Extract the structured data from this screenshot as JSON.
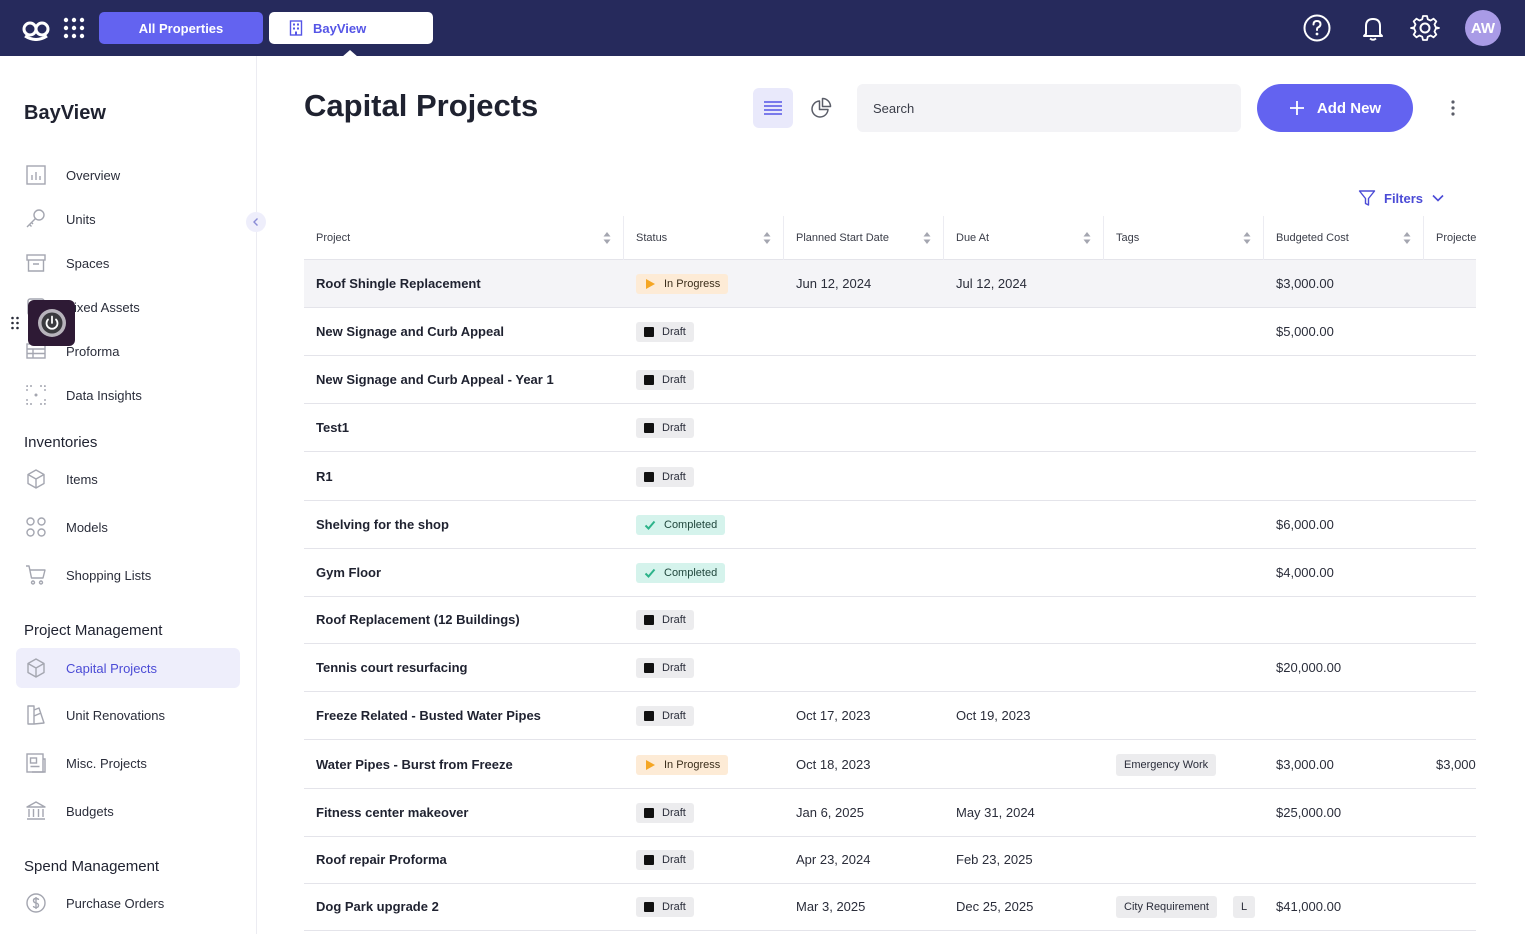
{
  "topbar": {
    "all_properties_label": "All Properties",
    "property_tab_label": "BayView",
    "avatar_initials": "AW"
  },
  "sidebar": {
    "title": "BayView",
    "main_items": [
      {
        "label": "Overview",
        "icon": "chart-icon"
      },
      {
        "label": "Units",
        "icon": "key-icon"
      },
      {
        "label": "Spaces",
        "icon": "box-icon"
      },
      {
        "label": "Fixed Assets",
        "icon": "asset-icon"
      },
      {
        "label": "Proforma",
        "icon": "table-icon"
      },
      {
        "label": "Data Insights",
        "icon": "insights-icon"
      }
    ],
    "inventories": {
      "title": "Inventories",
      "items": [
        {
          "label": "Items",
          "icon": "cube-icon"
        },
        {
          "label": "Models",
          "icon": "grid-icon"
        },
        {
          "label": "Shopping Lists",
          "icon": "cart-icon"
        }
      ]
    },
    "project_management": {
      "title": "Project Management",
      "items": [
        {
          "label": "Capital Projects",
          "icon": "cube-icon",
          "active": true
        },
        {
          "label": "Unit Renovations",
          "icon": "paint-icon"
        },
        {
          "label": "Misc. Projects",
          "icon": "document-icon"
        },
        {
          "label": "Budgets",
          "icon": "bank-icon"
        }
      ]
    },
    "spend_management": {
      "title": "Spend Management",
      "items": [
        {
          "label": "Purchase Orders",
          "icon": "dollar-icon"
        }
      ]
    }
  },
  "main": {
    "title": "Capital Projects",
    "search_placeholder": "Search",
    "add_new_label": "Add New",
    "filters_label": "Filters"
  },
  "table": {
    "columns": [
      "Project",
      "Status",
      "Planned Start Date",
      "Due At",
      "Tags",
      "Budgeted Cost",
      "Projected"
    ],
    "rows": [
      {
        "project": "Roof Shingle Replacement",
        "status": "In Progress",
        "start": "Jun 12, 2024",
        "due": "Jul 12, 2024",
        "tags": [],
        "budget": "$3,000.00",
        "projected": ""
      },
      {
        "project": "New Signage and Curb Appeal",
        "status": "Draft",
        "start": "",
        "due": "",
        "tags": [],
        "budget": "$5,000.00",
        "projected": ""
      },
      {
        "project": "New Signage and Curb Appeal - Year 1",
        "status": "Draft",
        "start": "",
        "due": "",
        "tags": [],
        "budget": "",
        "projected": ""
      },
      {
        "project": "Test1",
        "status": "Draft",
        "start": "",
        "due": "",
        "tags": [],
        "budget": "",
        "projected": ""
      },
      {
        "project": "R1",
        "status": "Draft",
        "start": "",
        "due": "",
        "tags": [],
        "budget": "",
        "projected": ""
      },
      {
        "project": "Shelving for the shop",
        "status": "Completed",
        "start": "",
        "due": "",
        "tags": [],
        "budget": "$6,000.00",
        "projected": ""
      },
      {
        "project": "Gym Floor",
        "status": "Completed",
        "start": "",
        "due": "",
        "tags": [],
        "budget": "$4,000.00",
        "projected": ""
      },
      {
        "project": "Roof Replacement (12 Buildings)",
        "status": "Draft",
        "start": "",
        "due": "",
        "tags": [],
        "budget": "",
        "projected": ""
      },
      {
        "project": "Tennis court resurfacing",
        "status": "Draft",
        "start": "",
        "due": "",
        "tags": [],
        "budget": "$20,000.00",
        "projected": ""
      },
      {
        "project": "Freeze Related - Busted Water Pipes",
        "status": "Draft",
        "start": "Oct 17, 2023",
        "due": "Oct 19, 2023",
        "tags": [],
        "budget": "",
        "projected": ""
      },
      {
        "project": "Water Pipes - Burst from Freeze",
        "status": "In Progress",
        "start": "Oct 18, 2023",
        "due": "",
        "tags": [
          "Emergency Work"
        ],
        "budget": "$3,000.00",
        "projected": "$3,000"
      },
      {
        "project": "Fitness center makeover",
        "status": "Draft",
        "start": "Jan 6, 2025",
        "due": "May 31, 2024",
        "tags": [],
        "budget": "$25,000.00",
        "projected": ""
      },
      {
        "project": "Roof repair Proforma",
        "status": "Draft",
        "start": "Apr 23, 2024",
        "due": "Feb 23, 2025",
        "tags": [],
        "budget": "",
        "projected": ""
      },
      {
        "project": "Dog Park upgrade 2",
        "status": "Draft",
        "start": "Mar 3, 2025",
        "due": "Dec 25, 2025",
        "tags": [
          "City Requirement",
          "L"
        ],
        "budget": "$41,000.00",
        "projected": ""
      }
    ]
  },
  "colors": {
    "topbar": "#262a5c",
    "accent": "#6363f0",
    "in_progress": "#f5a623",
    "completed": "#2db38a"
  }
}
